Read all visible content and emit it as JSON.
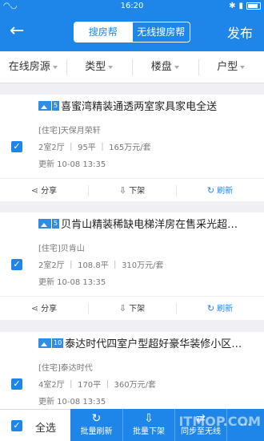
{
  "status": {
    "time": "16:20"
  },
  "nav": {
    "back_icon": "back-arrow-icon",
    "tabs": [
      "搜房帮",
      "无线搜房帮"
    ],
    "publish": "发布"
  },
  "filters": [
    "在线房源",
    "类型",
    "楼盘",
    "户型"
  ],
  "listings": [
    {
      "photo_count": "5",
      "title": "喜蜜湾精装通透两室家具家电全送",
      "estate": "[住宅]天保月荣轩",
      "spec": "2室2厅 ｜ 95平 ｜ 165万元/套",
      "updated": "更新 10-08 13:35",
      "checked": true
    },
    {
      "photo_count": "5",
      "title": "贝肯山精装稀缺电梯洋房在售采光超…",
      "estate": "[住宅]贝肯山",
      "spec": "2室2厅 ｜ 108.8平 ｜ 310万元/套",
      "updated": "更新 10-08 13:35",
      "checked": true
    },
    {
      "photo_count": "10",
      "title": "泰达时代四室户型超好豪华装修小区…",
      "estate": "[住宅]泰达时代",
      "spec": "4室2厅 ｜ 170平 ｜ 360万元/套",
      "updated": "更新 10-08 13:35",
      "checked": true
    }
  ],
  "actions": {
    "share": "分享",
    "offline": "下架",
    "refresh": "刷新"
  },
  "bottom": {
    "select_all": "全选",
    "batch_refresh": "批量刷新",
    "batch_offline": "批量下架",
    "sync_wireless": "同步至无线"
  },
  "watermark": "ITMOP.COM",
  "colors": {
    "primary": "#1e86e8",
    "background": "#efeff4"
  }
}
